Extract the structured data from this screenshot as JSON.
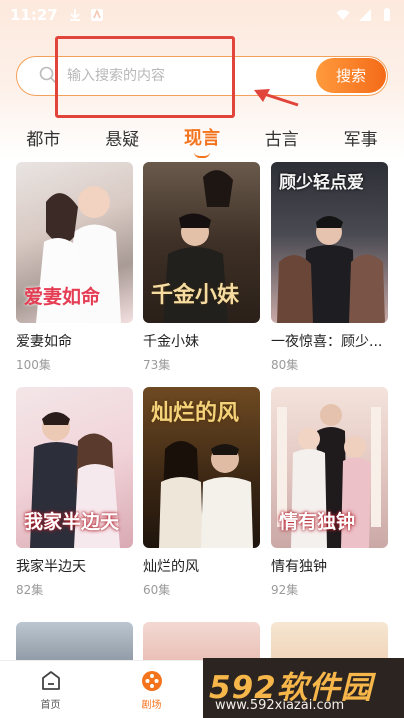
{
  "status_bar": {
    "time": "11:27"
  },
  "search": {
    "placeholder": "输入搜索的内容",
    "button_label": "搜索"
  },
  "tabs": [
    {
      "label": "都市",
      "active": false
    },
    {
      "label": "悬疑",
      "active": false
    },
    {
      "label": "现言",
      "active": true
    },
    {
      "label": "古言",
      "active": false
    },
    {
      "label": "军事",
      "active": false
    }
  ],
  "dramas": [
    {
      "title": "爱妻如命",
      "episodes": "100集",
      "cover_text": "爱妻如命"
    },
    {
      "title": "千金小妹",
      "episodes": "73集",
      "cover_text": "千金小妹"
    },
    {
      "title": "一夜惊喜：顾少...",
      "episodes": "80集",
      "cover_text": "顾少轻点爱"
    },
    {
      "title": "我家半边天",
      "episodes": "82集",
      "cover_text": "我家半边天"
    },
    {
      "title": "灿烂的风",
      "episodes": "60集",
      "cover_text": "灿烂的风"
    },
    {
      "title": "情有独钟",
      "episodes": "92集",
      "cover_text": "情有独钟"
    }
  ],
  "bottom_nav": [
    {
      "label": "首页",
      "icon": "home-icon",
      "active": false
    },
    {
      "label": "剧场",
      "icon": "theater-icon",
      "active": true
    }
  ],
  "watermark": {
    "logo": "592软件园",
    "url": "www.592xiazai.com"
  },
  "colors": {
    "accent": "#f4741e",
    "highlight": "#e0443a"
  }
}
